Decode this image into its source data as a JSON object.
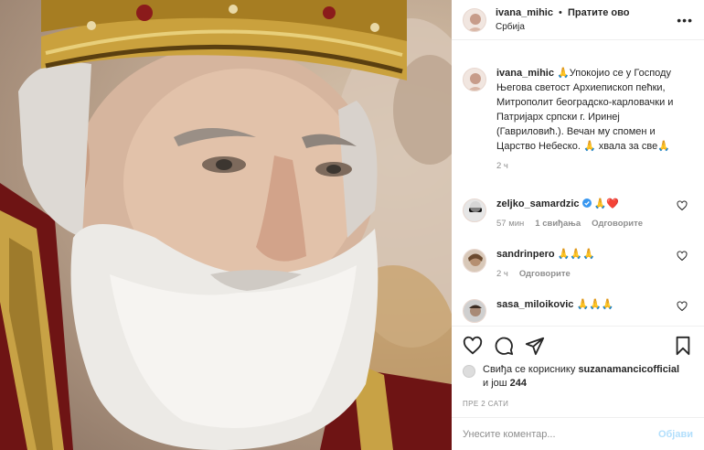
{
  "post": {
    "username": "ivana_mihic",
    "separator": "•",
    "follow_label": "Пратите ово",
    "location": "Србија",
    "more_icon": "more-options-icon"
  },
  "caption": {
    "username": "ivana_mihic",
    "text": "🙏Упокојио се у Господу Његова светост Архиепископ пећки, Митрополит београдско-карловачки и Патријарх српски г. Иринеј (Гавриловић.). Вечан му спомен и Царство Небеско. 🙏 хвала за све🙏",
    "time": "2 ч"
  },
  "comments": [
    {
      "username": "zeljko_samardzic",
      "verified": true,
      "text": "🙏❤️",
      "time": "57 мин",
      "likes": "1 свиђања",
      "reply": "Одговорите"
    },
    {
      "username": "sandrinpero",
      "verified": false,
      "text": "🙏🙏🙏",
      "time": "2 ч",
      "likes": "",
      "reply": "Одговорите"
    },
    {
      "username": "sasa_miloikovic",
      "verified": false,
      "text": "🙏🙏🙏",
      "time": "",
      "likes": "",
      "reply": ""
    }
  ],
  "likes": {
    "prefix": "Свиђа се кориснику",
    "user": "suzanamancicofficial",
    "and_more": "и још",
    "count": "244"
  },
  "posted_ago": "ПРЕ 2 САТИ",
  "composer": {
    "placeholder": "Унесите коментар...",
    "post_label": "Објави"
  },
  "icons": [
    "heart-icon",
    "comment-icon",
    "share-icon",
    "bookmark-icon"
  ],
  "colors": {
    "link_blue": "#b2dffc",
    "muted": "#8e8e8e",
    "text": "#262626",
    "verified": "#3897f0",
    "heart_red": "#ed4956"
  }
}
